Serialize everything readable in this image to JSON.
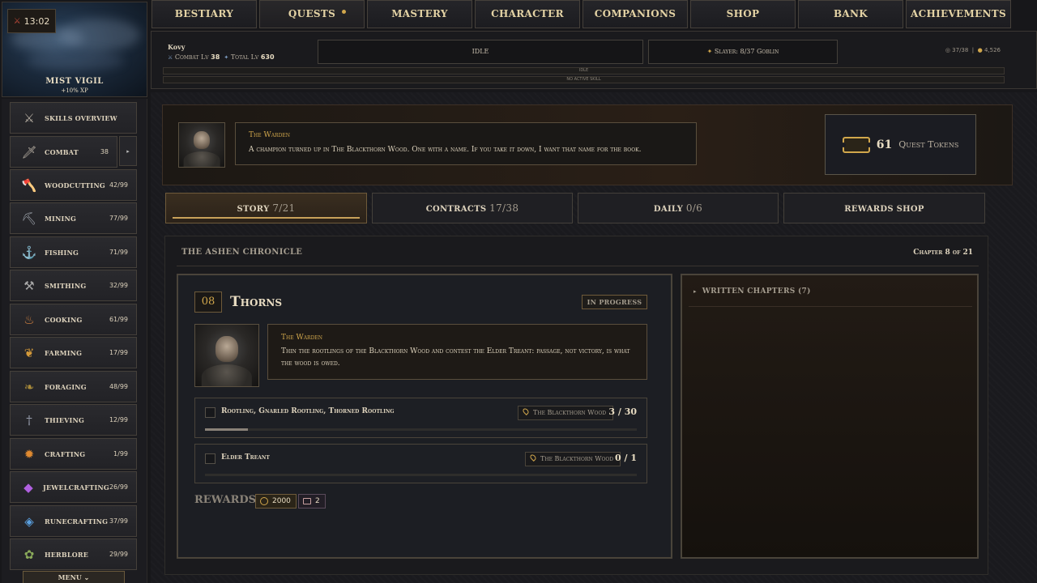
{
  "header": {
    "timer": "13:02",
    "region_name": "MIST VIGIL",
    "region_bonus": "+10% XP"
  },
  "nav": {
    "tabs": [
      "BESTIARY",
      "QUESTS",
      "MASTERY",
      "CHARACTER",
      "COMPANIONS",
      "SHOP",
      "BANK",
      "ACHIEVEMENTS"
    ],
    "active_tab": "QUESTS"
  },
  "status": {
    "player_name": "Kovy",
    "combat_label": "Combat Lv",
    "combat_level": "38",
    "total_label": "Total Lv",
    "total_level": "630",
    "activity": "IDLE",
    "slayer": "Slayer: 8/37 Goblin",
    "inventory": "37/38",
    "gold": "4,526",
    "line1": "IDLE",
    "line2": "NO ACTIVE SKILL"
  },
  "sidebar": {
    "items": [
      {
        "label": "SKILLS OVERVIEW",
        "level": "",
        "icon": "swords-icon"
      },
      {
        "label": "COMBAT",
        "level": "38",
        "icon": "sword-icon"
      },
      {
        "label": "WOODCUTTING",
        "level": "42/99",
        "icon": "axe-icon"
      },
      {
        "label": "MINING",
        "level": "77/99",
        "icon": "pickaxe-icon"
      },
      {
        "label": "FISHING",
        "level": "71/99",
        "icon": "fishhook-icon"
      },
      {
        "label": "SMITHING",
        "level": "32/99",
        "icon": "anvil-icon"
      },
      {
        "label": "COOKING",
        "level": "61/99",
        "icon": "pot-icon"
      },
      {
        "label": "FARMING",
        "level": "17/99",
        "icon": "wheat-icon"
      },
      {
        "label": "FORAGING",
        "level": "48/99",
        "icon": "leaf-icon"
      },
      {
        "label": "THIEVING",
        "level": "12/99",
        "icon": "dagger-icon"
      },
      {
        "label": "CRAFTING",
        "level": "1/99",
        "icon": "hammer-icon"
      },
      {
        "label": "JEWELCRAFTING",
        "level": "26/99",
        "icon": "gem-icon"
      },
      {
        "label": "RUNECRAFTING",
        "level": "37/99",
        "icon": "rune-icon"
      },
      {
        "label": "HERBLORE",
        "level": "29/99",
        "icon": "herb-icon"
      }
    ],
    "menu_label": "MENU"
  },
  "intro": {
    "speaker": "The Warden",
    "text": "A champion turned up in The Blackthorn Wood. One with a name. If you take it down, I want that name for the book."
  },
  "tokens": {
    "count": "61",
    "label": "Quest Tokens"
  },
  "quest_tabs": [
    {
      "label": "STORY",
      "count": "7/21"
    },
    {
      "label": "CONTRACTS",
      "count": "17/38"
    },
    {
      "label": "DAILY",
      "count": "0/6"
    },
    {
      "label": "REWARDS SHOP",
      "count": ""
    }
  ],
  "chronicle": {
    "title": "THE ASHEN CHRONICLE",
    "chapter_indicator": "Chapter 8 of 21"
  },
  "quest": {
    "number": "08",
    "title": "Thorns",
    "status": "IN PROGRESS",
    "speaker": "The Warden",
    "text": "Thin the rootlings of the Blackthorn Wood and contest the Elder Treant: passage, not victory, is what the wood is owed.",
    "objectives": [
      {
        "name": "Rootling, Gnarled Rootling, Thorned Rootling",
        "location": "The Blackthorn Wood",
        "count": "3 / 30",
        "progress": 0.1
      },
      {
        "name": "Elder Treant",
        "location": "The Blackthorn Wood",
        "count": "0 / 1",
        "progress": 0.0
      }
    ],
    "rewards_label": "REWARDS:",
    "rewards": [
      {
        "value": "2000",
        "icon": "coin-icon"
      },
      {
        "value": "2",
        "icon": "ticket-icon"
      }
    ]
  },
  "written_chapters": {
    "label": "WRITTEN CHAPTERS (7)"
  }
}
